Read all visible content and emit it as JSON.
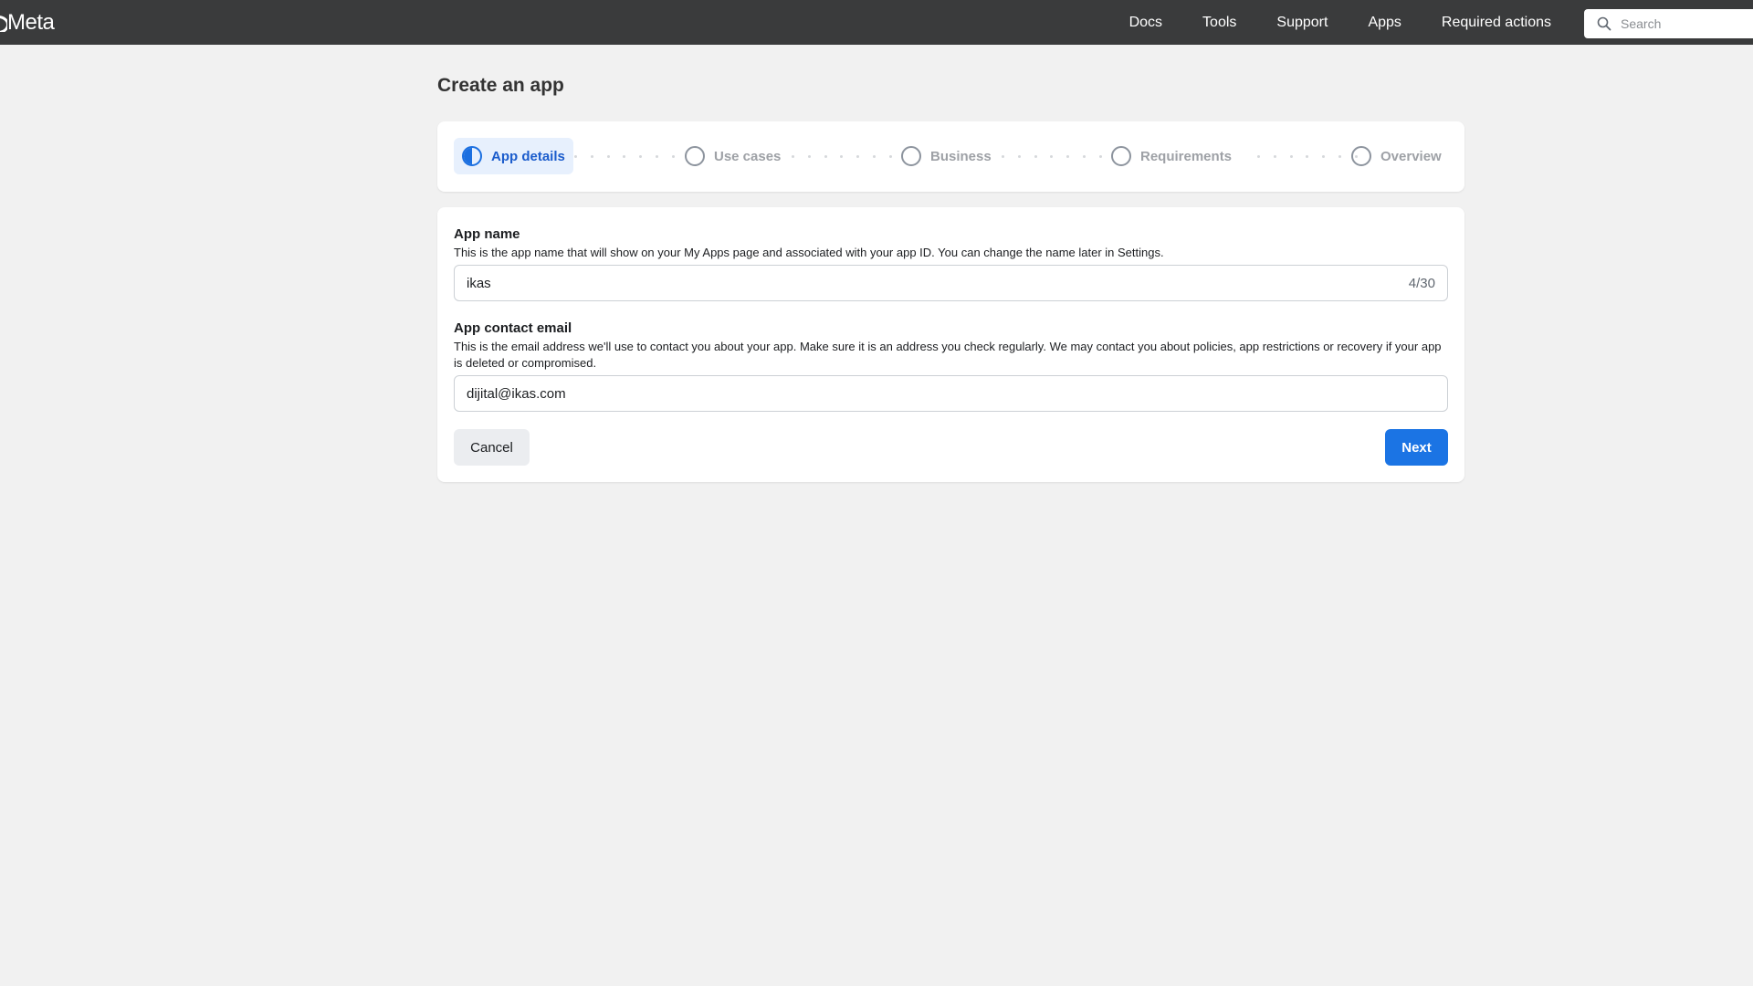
{
  "header": {
    "brand": "Meta",
    "nav": [
      "Docs",
      "Tools",
      "Support",
      "Apps",
      "Required actions"
    ],
    "search_placeholder": "Search"
  },
  "page": {
    "title": "Create an app"
  },
  "stepper": {
    "steps": [
      {
        "label": "App details",
        "state": "active"
      },
      {
        "label": "Use cases",
        "state": "pending"
      },
      {
        "label": "Business",
        "state": "pending"
      },
      {
        "label": "Requirements",
        "state": "pending"
      },
      {
        "label": "Overview",
        "state": "pending"
      }
    ]
  },
  "form": {
    "app_name": {
      "label": "App name",
      "help": "This is the app name that will show on your My Apps page and associated with your app ID. You can change the name later in Settings.",
      "value": "ikas",
      "counter": "4/30"
    },
    "contact_email": {
      "label": "App contact email",
      "help": "This is the email address we'll use to contact you about your app. Make sure it is an address you check regularly. We may contact you about policies, app restrictions or recovery if your app is deleted or compromised.",
      "value": "dijital@ikas.com"
    },
    "cancel_label": "Cancel",
    "next_label": "Next"
  },
  "colors": {
    "accent": "#1b74e4",
    "topbar": "#3a3b3c",
    "background": "#f1f1f1"
  }
}
